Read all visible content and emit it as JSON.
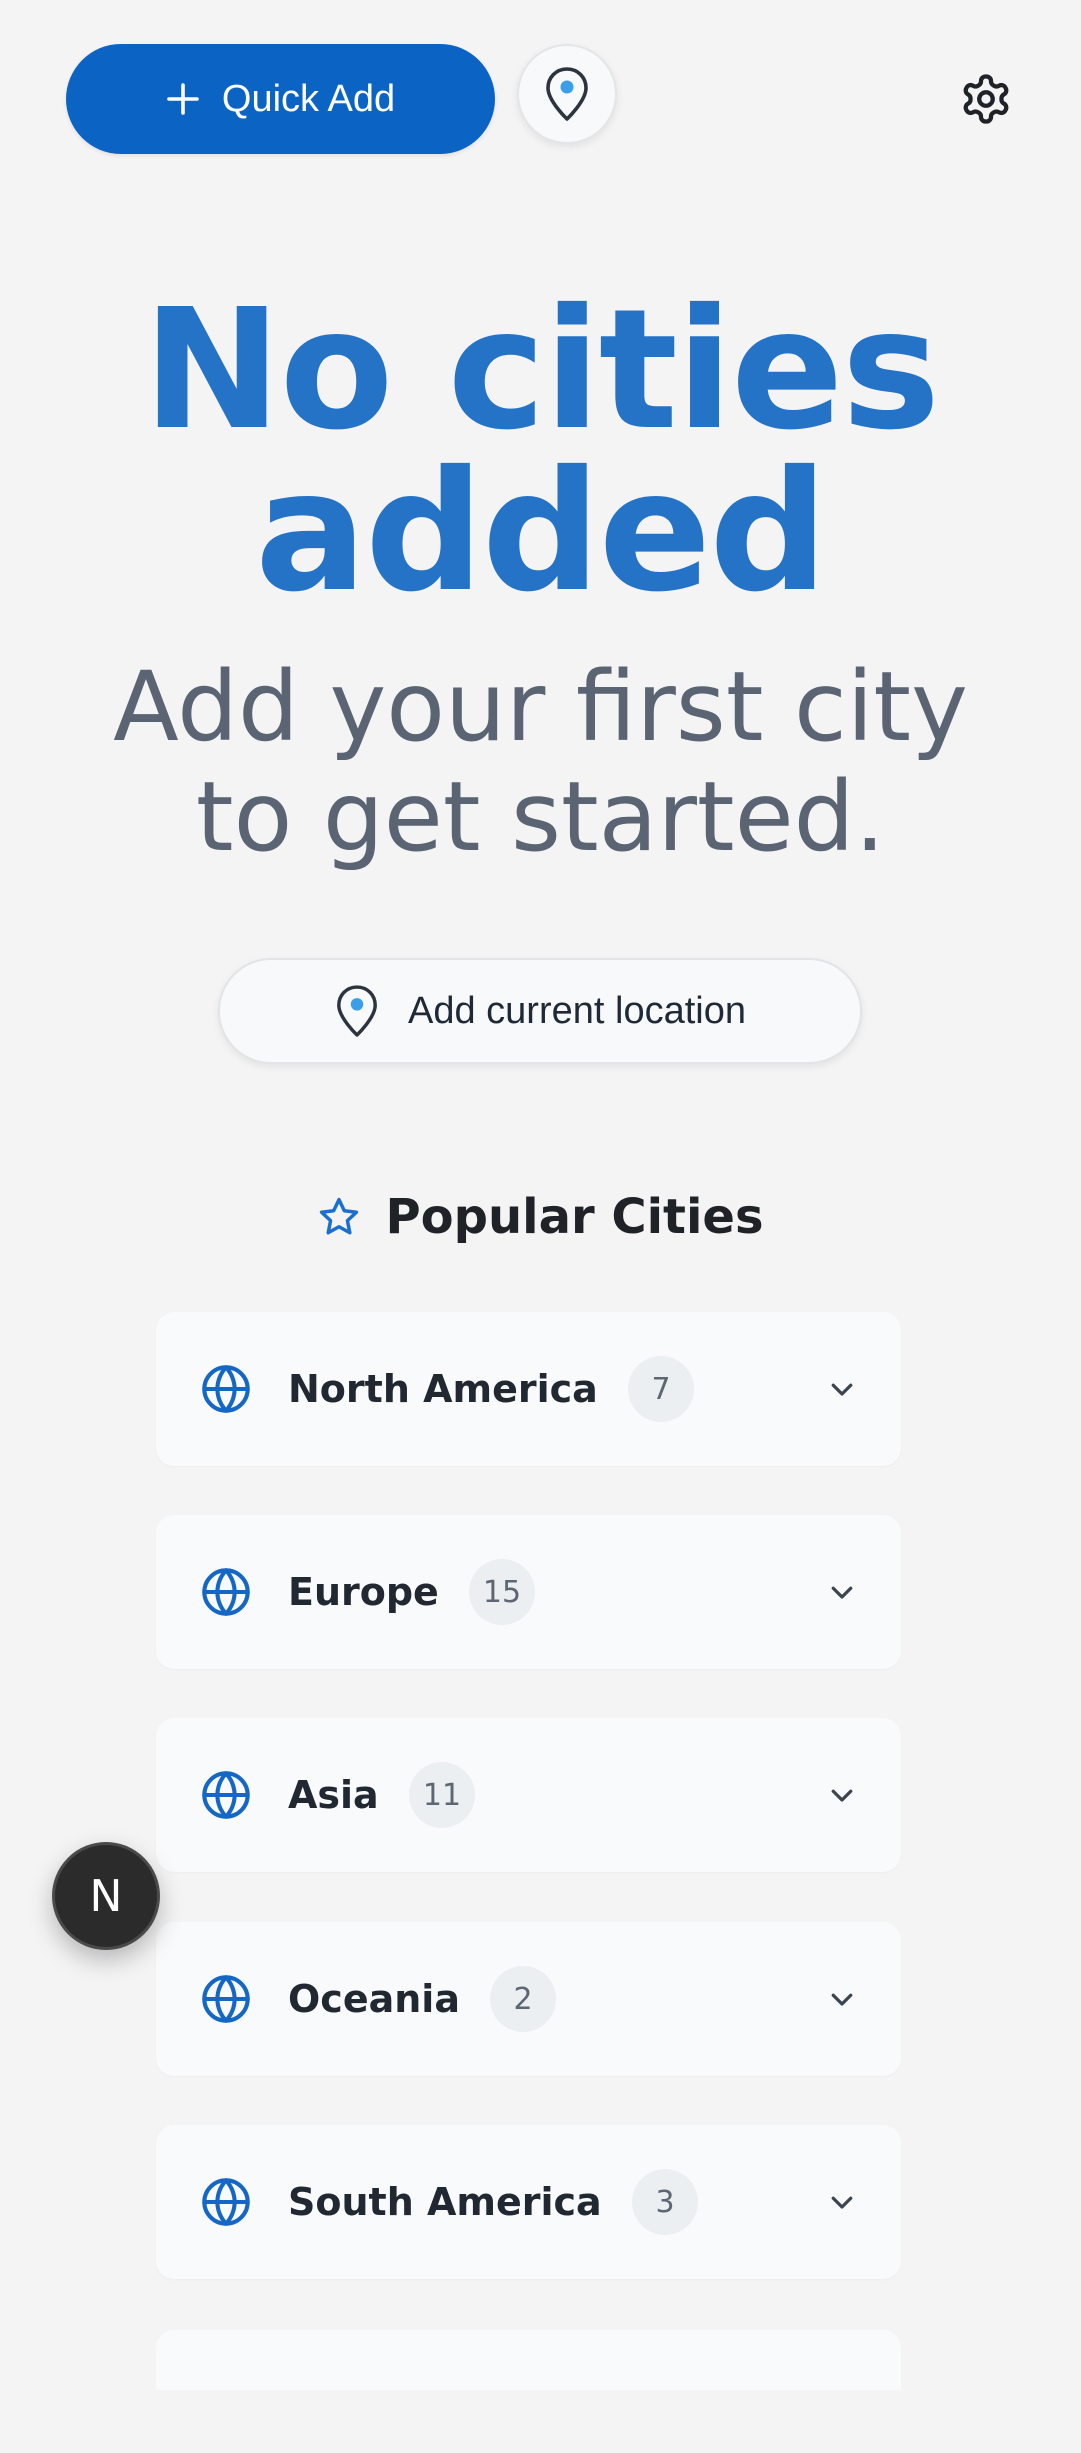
{
  "toolbar": {
    "quick_add_label": "Quick Add",
    "icons": {
      "quick_add": "plus-icon",
      "location": "map-pin-icon",
      "settings": "gear-icon"
    }
  },
  "empty_state": {
    "title_line1": "No cities",
    "title_line2": "added",
    "subtitle_line1": "Add your first city",
    "subtitle_line2": "to get started.",
    "add_current_location_label": "Add current location"
  },
  "popular": {
    "title": "Popular Cities",
    "regions": [
      {
        "name": "North America",
        "count": "7"
      },
      {
        "name": "Europe",
        "count": "15"
      },
      {
        "name": "Asia",
        "count": "11"
      },
      {
        "name": "Oceania",
        "count": "2"
      },
      {
        "name": "South America",
        "count": "3"
      }
    ]
  },
  "floating_badge": {
    "letter": "N"
  },
  "colors": {
    "accent": "#0b64c4",
    "title": "#2573c7",
    "subtitle": "#5a6472",
    "background": "#f4f4f5"
  }
}
